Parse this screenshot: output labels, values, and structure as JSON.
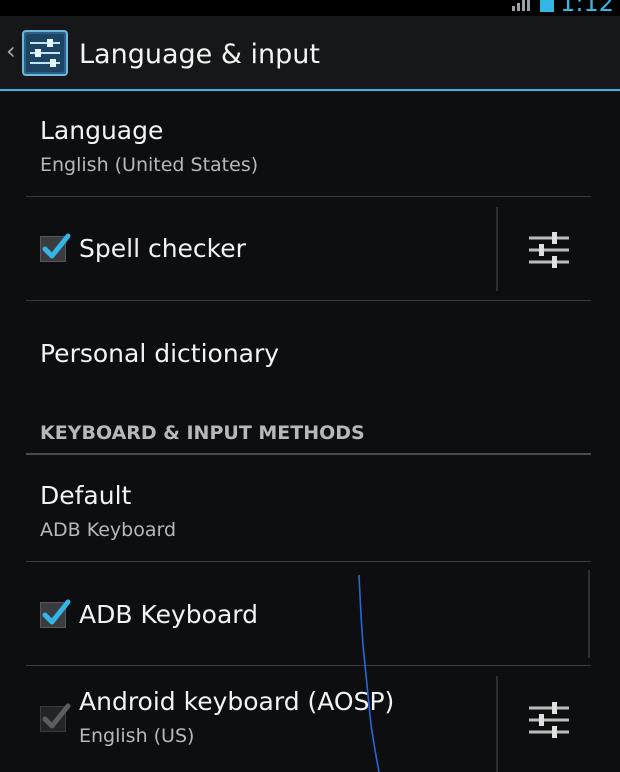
{
  "status_bar": {
    "time": "1:12",
    "icons": [
      "signal-icon",
      "battery-icon"
    ]
  },
  "action_bar": {
    "title": "Language & input",
    "icons": [
      "up-caret-icon",
      "settings-app-icon"
    ]
  },
  "items": {
    "language": {
      "title": "Language",
      "summary": "English (United States)"
    },
    "spell_checker": {
      "title": "Spell checker",
      "checked": true
    },
    "personal_dictionary": {
      "title": "Personal dictionary"
    }
  },
  "section": {
    "header": "KEYBOARD & INPUT METHODS"
  },
  "keyboard_items": {
    "default": {
      "title": "Default",
      "summary": "ADB Keyboard"
    },
    "adb_keyboard": {
      "title": "ADB Keyboard",
      "checked": true
    },
    "android_keyboard": {
      "title": "Android keyboard (AOSP)",
      "summary": "English (US)",
      "checked": true,
      "enabled": false
    }
  },
  "colors": {
    "accent": "#33b5e5",
    "background": "#0d0e10",
    "divider": "#3a3b3e",
    "secondary_text": "#b8b8b8"
  }
}
